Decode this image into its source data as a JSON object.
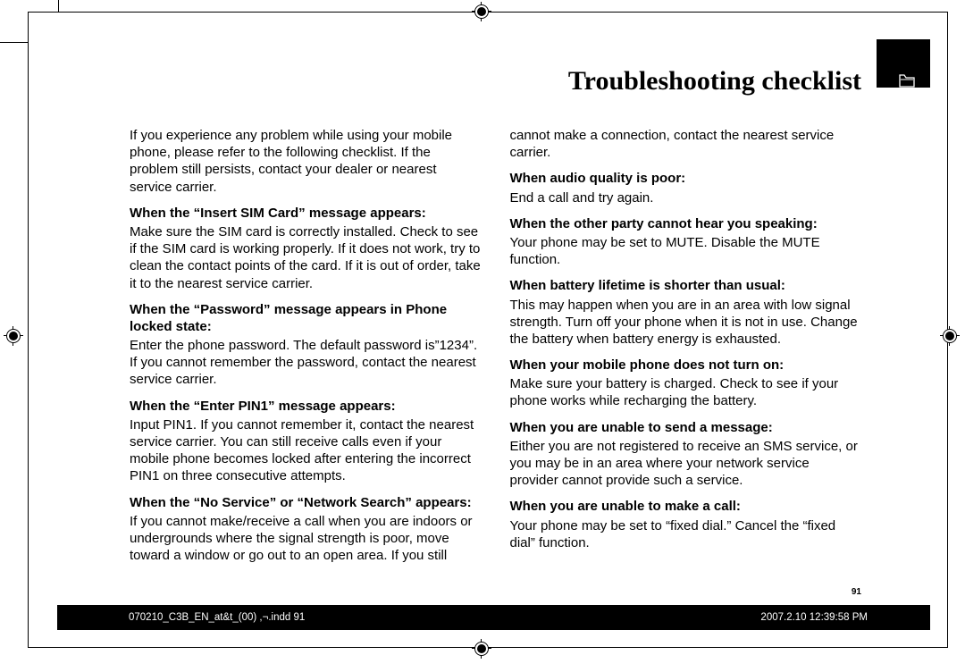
{
  "chapter_title": "Troubleshooting checklist",
  "page_number": "91",
  "footer": {
    "left": "070210_C3B_EN_at&t_(00) ,¬.indd   91",
    "right": "2007.2.10   12:39:58 PM"
  },
  "intro": "If you experience any problem while using your mobile phone, please refer to the following checklist. If the problem still persists, contact your dealer or nearest service carrier.",
  "sections": [
    {
      "title": "When the “Insert SIM Card” message appears:",
      "body": "Make sure the SIM card is correctly installed. Check to see if the SIM card is working properly. If it does not work, try to clean the contact points of the card. If it is out of order, take it to the nearest service carrier."
    },
    {
      "title": "When the “Password” message appears in Phone locked state:",
      "body": "Enter the phone password. The default password is”1234”. If you cannot remember the password, contact the nearest service carrier."
    },
    {
      "title": "When the “Enter PIN1” message appears:",
      "body": "Input PIN1. If you cannot remember it, contact the nearest service carrier. You can still receive calls even if your mobile phone becomes locked after entering the incorrect PIN1 on three consecutive attempts."
    },
    {
      "title": "When the “No Service” or “Network Search” appears:",
      "body": "If you cannot make/receive a call when you are indoors or undergrounds where the signal strength is poor, move toward a window or go out to an open area. If you still cannot make a connection, contact the nearest service carrier."
    },
    {
      "title": "When audio quality is poor:",
      "body": "End a call and try again."
    },
    {
      "title": "When the other party cannot hear you speaking:",
      "body": "Your phone may be set to MUTE. Disable the MUTE function."
    },
    {
      "title": "When battery lifetime is shorter than usual:",
      "body": "This may happen when you are in an area with low signal strength. Turn off your phone when it is not in use. Change the battery when battery energy is exhausted."
    },
    {
      "title": "When your mobile phone does not turn on:",
      "body": "Make sure your battery is charged. Check to see if your phone works while recharging the battery."
    },
    {
      "title": "When you are unable to send a message:",
      "body": "Either you are not registered to receive an SMS service, or you may be in an area where your network service provider cannot provide such a service."
    },
    {
      "title": "When you are unable to make a call:",
      "body": "Your phone may be set to “fixed dial.” Cancel the “fixed dial” function."
    }
  ]
}
